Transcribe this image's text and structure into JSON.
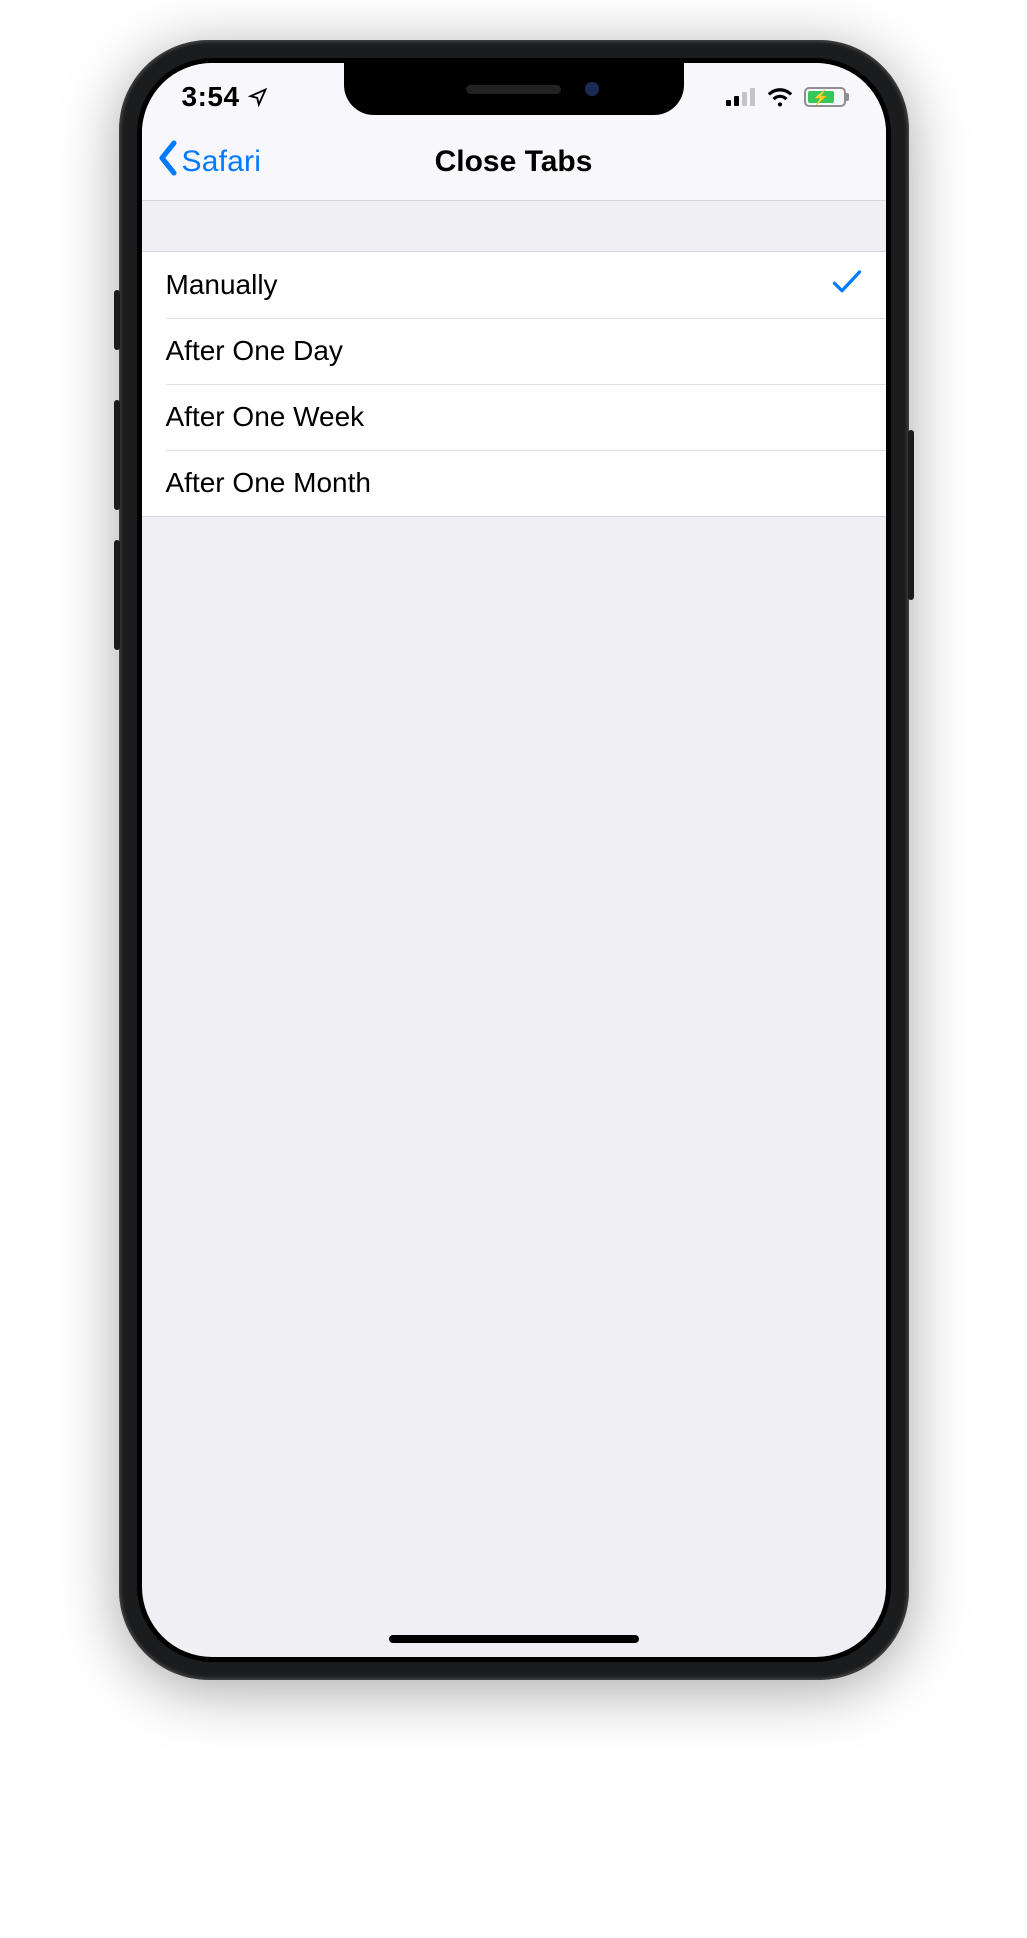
{
  "status": {
    "time": "3:54",
    "cellular_bars": 2,
    "wifi": true,
    "battery_charging": true
  },
  "nav": {
    "back_label": "Safari",
    "title": "Close Tabs"
  },
  "options": [
    {
      "label": "Manually",
      "selected": true
    },
    {
      "label": "After One Day",
      "selected": false
    },
    {
      "label": "After One Week",
      "selected": false
    },
    {
      "label": "After One Month",
      "selected": false
    }
  ]
}
